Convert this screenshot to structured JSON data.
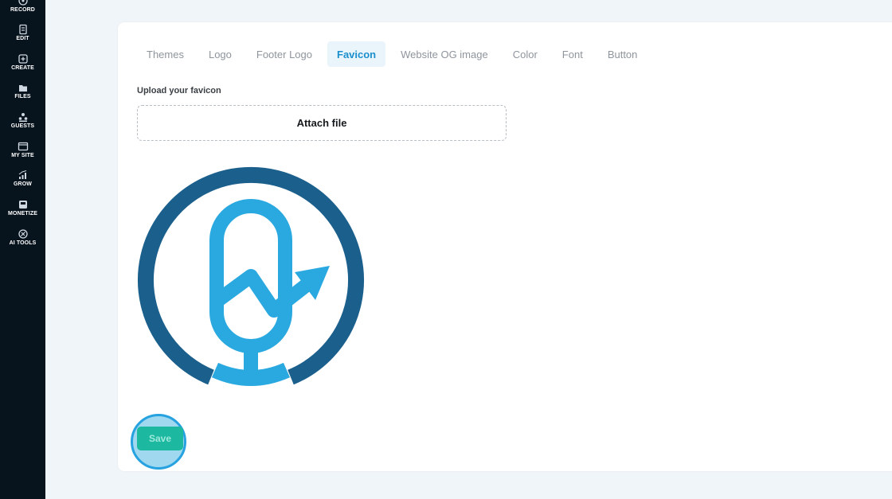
{
  "sidebar": {
    "items": [
      {
        "label": "RECORD",
        "icon": "microphone-icon"
      },
      {
        "label": "EDIT",
        "icon": "document-edit-icon"
      },
      {
        "label": "CREATE",
        "icon": "create-icon"
      },
      {
        "label": "FILES",
        "icon": "folder-icon"
      },
      {
        "label": "GUESTS",
        "icon": "guests-icon"
      },
      {
        "label": "MY SITE",
        "icon": "website-icon"
      },
      {
        "label": "GROW",
        "icon": "growth-chart-icon"
      },
      {
        "label": "MONETIZE",
        "icon": "monetize-icon"
      },
      {
        "label": "AI TOOLS",
        "icon": "ai-tools-icon"
      }
    ]
  },
  "tabs": [
    {
      "label": "Themes",
      "active": false
    },
    {
      "label": "Logo",
      "active": false
    },
    {
      "label": "Footer Logo",
      "active": false
    },
    {
      "label": "Favicon",
      "active": true
    },
    {
      "label": "Website OG image",
      "active": false
    },
    {
      "label": "Color",
      "active": false
    },
    {
      "label": "Font",
      "active": false
    },
    {
      "label": "Button",
      "active": false
    }
  ],
  "upload": {
    "label": "Upload your favicon",
    "button_label": "Attach file"
  },
  "preview": {
    "icon": "podcast-microphone-growth-logo"
  },
  "save": {
    "label": "Save"
  },
  "colors": {
    "sidebar_bg": "#07131d",
    "accent_blue": "#1b8fcd",
    "save_green": "#1cb89f",
    "logo_dark_blue": "#1b5f8c",
    "logo_light_blue": "#2aa9e0"
  }
}
